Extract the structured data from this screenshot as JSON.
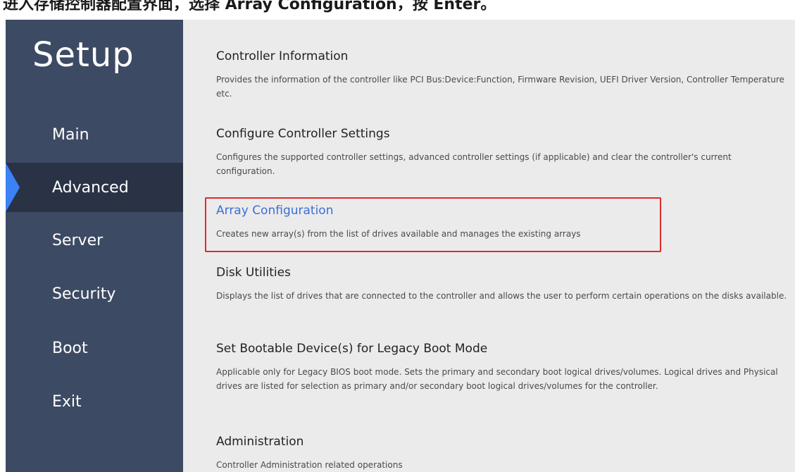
{
  "caption": {
    "text": "进入存储控制器配置界面，选择 Array Configuration，按 Enter。"
  },
  "sidebar": {
    "logo": "Setup",
    "items": [
      {
        "label": "Main",
        "active": false
      },
      {
        "label": "Advanced",
        "active": true
      },
      {
        "label": "Server",
        "active": false
      },
      {
        "label": "Security",
        "active": false
      },
      {
        "label": "Boot",
        "active": false
      },
      {
        "label": "Exit",
        "active": false
      }
    ]
  },
  "main": {
    "sections": [
      {
        "title": "Controller Information",
        "desc": "Provides the information of the controller like PCI Bus:Device:Function, Firmware Revision, UEFI Driver Version, Controller Temperature etc."
      },
      {
        "title": "Configure Controller Settings",
        "desc": "Configures the supported controller settings, advanced controller settings (if applicable) and clear the controller's current configuration."
      },
      {
        "title": "Array Configuration",
        "desc": "Creates new array(s) from the list of drives available and manages the existing arrays",
        "selected": true
      },
      {
        "title": "Disk Utilities",
        "desc": "Displays the list of drives that are connected to the controller and allows the user to perform certain operations on the disks available."
      },
      {
        "title": "Set Bootable Device(s) for Legacy Boot Mode",
        "desc": "Applicable only for Legacy BIOS boot mode. Sets the primary and secondary boot logical drives/volumes. Logical drives and Physical drives are listed for selection as primary and/or secondary boot logical drives/volumes for the controller."
      },
      {
        "title": "Administration",
        "desc": "Controller Administration related operations"
      }
    ]
  },
  "colors": {
    "sidebar": "#3d4a63",
    "sidebar_active": "#2a3346",
    "active_marker": "#3b82f6",
    "content_bg": "#ebebeb",
    "selected_title": "#3b6fd4",
    "highlight_border": "#e02a2a"
  }
}
